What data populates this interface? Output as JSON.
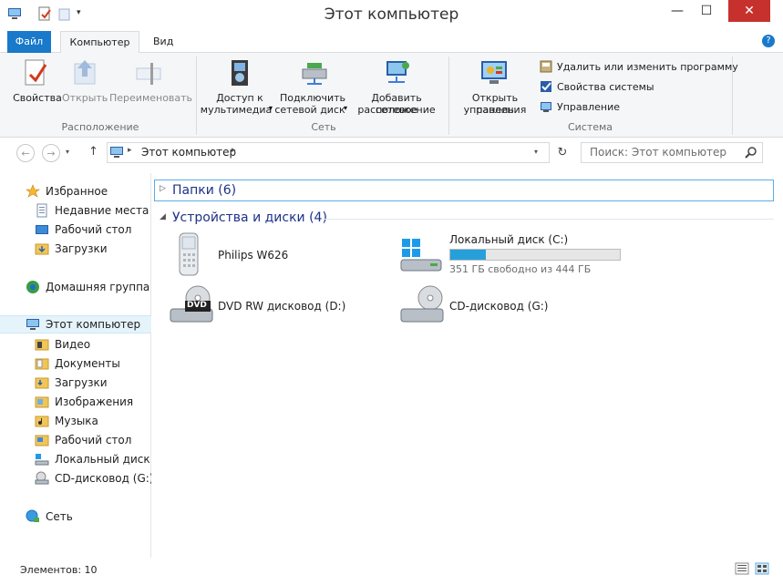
{
  "window": {
    "title": "Этот компьютер",
    "controls": {
      "minimize": "—",
      "maximize": "☐",
      "close": "✕"
    }
  },
  "ribbon_tabs": {
    "file": "Файл",
    "computer": "Компьютер",
    "view": "Вид"
  },
  "ribbon": {
    "location": {
      "properties": "Свойства",
      "open": "Открыть",
      "rename": "Переименовать",
      "label": "Расположение"
    },
    "network": {
      "media_line1": "Доступ к",
      "media_line2": "мультимедиа",
      "map_line1": "Подключить",
      "map_line2": "сетевой диск",
      "add_line1": "Добавить сетевое",
      "add_line2": "расположение",
      "label": "Сеть"
    },
    "system": {
      "cp_line1": "Открыть панель",
      "cp_line2": "управления",
      "uninstall": "Удалить или изменить программу",
      "props": "Свойства системы",
      "manage": "Управление",
      "label": "Система"
    }
  },
  "address": {
    "path": "Этот компьютер",
    "search_placeholder": "Поиск: Этот компьютер"
  },
  "nav": {
    "favorites": "Избранное",
    "recent": "Недавние места",
    "desktop": "Рабочий стол",
    "downloads": "Загрузки",
    "homegroup": "Домашняя группа",
    "this_pc": "Этот компьютер",
    "videos": "Видео",
    "documents": "Документы",
    "downloads2": "Загрузки",
    "pictures": "Изображения",
    "music": "Музыка",
    "desktop2": "Рабочий стол",
    "local_disk": "Локальный диск (C",
    "cd_drive": "CD-дисковод (G:)",
    "network": "Сеть"
  },
  "content": {
    "folders_group": "Папки (6)",
    "devices_group": "Устройства и диски (4)",
    "devices": {
      "phone": "Philips W626",
      "local_disk": "Локальный диск (C:)",
      "local_disk_free": "351 ГБ свободно из 444 ГБ",
      "local_disk_used_fraction": 0.21,
      "dvd": "DVD RW дисковод (D:)",
      "dvd_badge": "DVD",
      "cd": "CD-дисковод (G:)"
    }
  },
  "status": {
    "items": "Элементов: 10"
  },
  "colors": {
    "accent": "#1979ca",
    "close": "#c7312d",
    "group_head": "#1e3287",
    "usage_bar": "#26a0da"
  }
}
